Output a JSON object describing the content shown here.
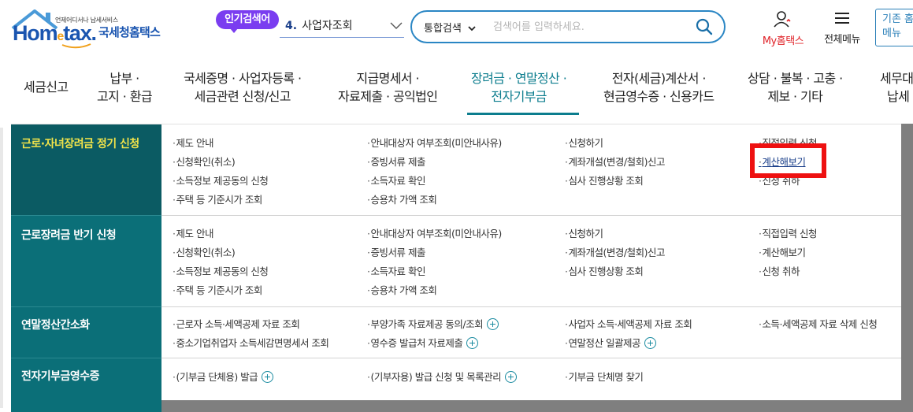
{
  "header": {
    "logo": {
      "tagline": "언제어디서나 납세서비스",
      "wordmark_main": "Hom",
      "wordmark_e": "e",
      "wordmark_end": "tax.",
      "name_kr": "국세청홈택스"
    },
    "popular_search": {
      "badge": "인기검색어",
      "rank": "4.",
      "keyword": "사업자조회"
    },
    "search": {
      "type": "통합검색",
      "placeholder": "검색어를 입력하세요."
    },
    "my_hometax": "My홈택스",
    "all_menu": "전체메뉴",
    "prev_button": [
      "기존 홈",
      "메뉴"
    ]
  },
  "gnb": {
    "items": [
      {
        "lines": [
          "세금신고"
        ]
      },
      {
        "lines": [
          "납부 ·",
          "고지 · 환급"
        ]
      },
      {
        "lines": [
          "국세증명 · 사업자등록 ·",
          "세금관련 신청/신고"
        ]
      },
      {
        "lines": [
          "지급명세서 ·",
          "자료제출 · 공익법인"
        ]
      },
      {
        "lines": [
          "장려금 · 연말정산 ·",
          "전자기부금"
        ],
        "active": true
      },
      {
        "lines": [
          "전자(세금)계산서 ·",
          "현금영수증 · 신용카드"
        ]
      },
      {
        "lines": [
          "상담 · 불복 · 고충 ·",
          "제보 · 기타"
        ]
      },
      {
        "lines": [
          "세무대",
          "납세"
        ]
      }
    ]
  },
  "mega_menu": {
    "sections": [
      {
        "title": "근로·자녀장려금 정기 신청",
        "active": true,
        "columns": [
          [
            "제도 안내",
            "신청확인(취소)",
            "소득정보 제공동의 신청",
            "주택 등 기준시가 조회"
          ],
          [
            "안내대상자 여부조회(미안내사유)",
            "증빙서류 제출",
            "소득자료 확인",
            "승용차 가액 조회"
          ],
          [
            "신청하기",
            "계좌개설(변경/철회)신고",
            "심사 진행상황 조회"
          ],
          [
            "직접입력 신청",
            "계산해보기",
            "신청 취하"
          ]
        ]
      },
      {
        "title": "근로장려금 반기 신청",
        "columns": [
          [
            "제도 안내",
            "신청확인(취소)",
            "소득정보 제공동의 신청",
            "주택 등 기준시가 조회"
          ],
          [
            "안내대상자 여부조회(미안내사유)",
            "증빙서류 제출",
            "소득자료 확인",
            "승용차 가액 조회"
          ],
          [
            "신청하기",
            "계좌개설(변경/철회)신고",
            "심사 진행상황 조회"
          ],
          [
            "직접입력 신청",
            "계산해보기",
            "신청 취하"
          ]
        ]
      },
      {
        "title": "연말정산간소화",
        "columns": [
          [
            "근로자 소득·세액공제 자료 조회",
            "중소기업취업자 소득세감면명세서 조회"
          ],
          [
            "부양가족 자료제공 동의/조회",
            "영수증 발급처 자료제출"
          ],
          [
            "사업자 소득·세액공제 자료 조회",
            "연말정산 일괄제공"
          ],
          [
            "소득·세액공제 자료 삭제 신청"
          ]
        ]
      },
      {
        "title": "전자기부금영수증",
        "columns": [
          [
            "(기부금 단체용) 발급"
          ],
          [
            "(기부자용) 발급 신청 및 목록관리"
          ],
          [
            "기부금 단체명 찾기"
          ]
        ]
      }
    ]
  }
}
